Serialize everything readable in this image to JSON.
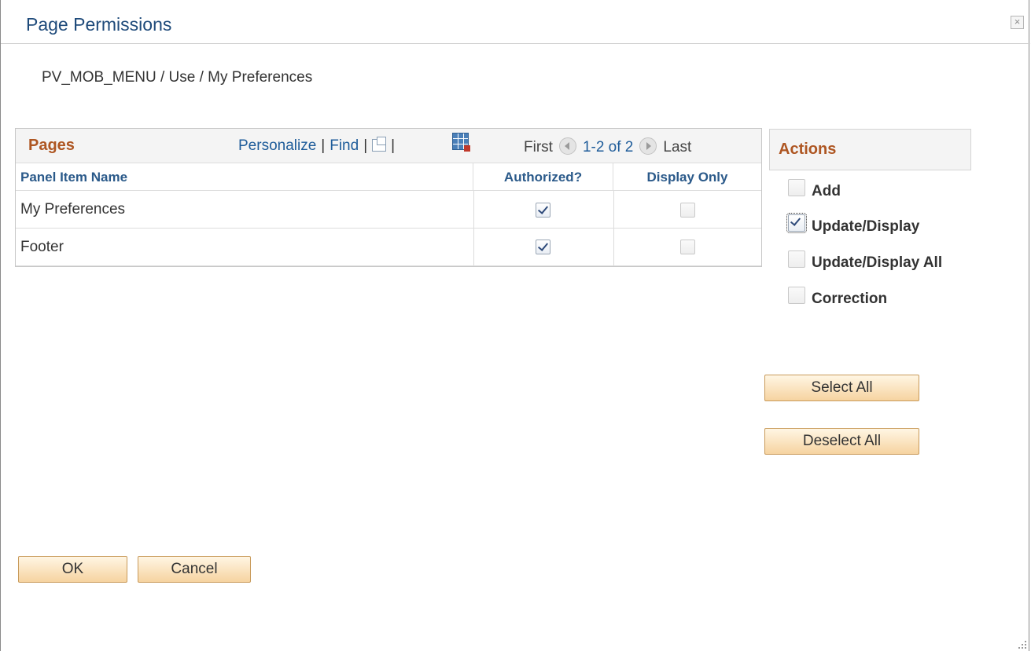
{
  "dialog": {
    "title": "Page Permissions",
    "close_symbol": "×",
    "breadcrumb": "PV_MOB_MENU / Use / My Preferences"
  },
  "grid": {
    "title": "Pages",
    "toolbar": {
      "personalize": "Personalize",
      "find": "Find",
      "separator": "|",
      "zoom_icon": "view-all-icon",
      "download_icon": "download-to-excel-icon"
    },
    "pager": {
      "first": "First",
      "count": "1-2 of 2",
      "last": "Last"
    },
    "columns": [
      "Panel Item Name",
      "Authorized?",
      "Display Only"
    ],
    "rows": [
      {
        "name": "My Preferences",
        "authorized": true,
        "display_only": false
      },
      {
        "name": "Footer",
        "authorized": true,
        "display_only": false
      }
    ]
  },
  "actions": {
    "title": "Actions",
    "items": [
      {
        "label": "Add",
        "checked": false
      },
      {
        "label": "Update/Display",
        "checked": true
      },
      {
        "label": "Update/Display All",
        "checked": false
      },
      {
        "label": "Correction",
        "checked": false
      }
    ],
    "select_all": "Select All",
    "deselect_all": "Deselect All"
  },
  "footer": {
    "ok": "OK",
    "cancel": "Cancel"
  },
  "colors": {
    "title_blue": "#1e4a7a",
    "section_orange": "#ae5622",
    "link_blue": "#1e5c9a",
    "button_bg": "#f6d3a0"
  }
}
